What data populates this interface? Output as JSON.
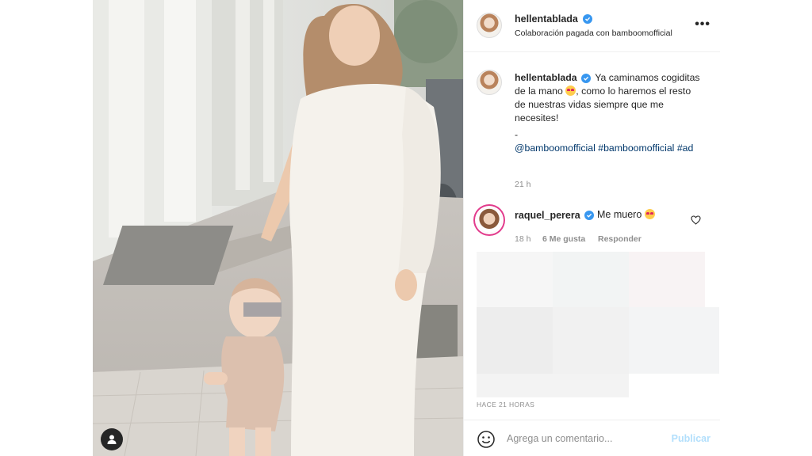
{
  "post": {
    "author": "hellentablada",
    "subtitle": "Colaboración pagada con bamboomofficial",
    "caption": {
      "text_before_emoji": "Ya caminamos cogiditas de la mano",
      "text_after_emoji": ", como lo haremos el resto de nuestras vidas siempre que me necesites!",
      "separator": "-",
      "tag_mention": "@bamboomofficial",
      "tag_hash": "#bamboomofficial",
      "tag_ad": "#ad",
      "time": "21 h"
    },
    "comment": {
      "author": "raquel_perera",
      "text": "Me muero",
      "time": "18 h",
      "likes": "6 Me gusta",
      "reply": "Responder"
    },
    "posted_ago": "HACE 21 HORAS",
    "composer": {
      "placeholder": "Agrega un comentario...",
      "publish": "Publicar"
    }
  },
  "icons": {
    "verified": "verified-badge-icon",
    "more": "more-options-icon",
    "heart": "heart-icon",
    "emoji": "emoji-icon",
    "user_tag": "user-tag-icon"
  },
  "colors": {
    "verified_blue": "#3897f0",
    "link_blue": "#00376b",
    "publish_disabled": "#b2dffc",
    "muted_gray": "#8e8e8e"
  }
}
